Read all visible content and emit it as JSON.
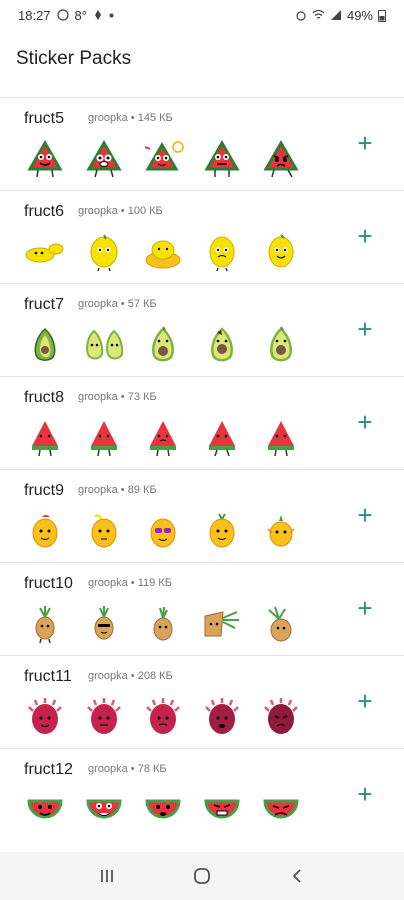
{
  "status": {
    "time": "18:27",
    "temp": "8°",
    "battery": "49%"
  },
  "app": {
    "title": "Sticker Packs"
  },
  "packs": [
    {
      "name": "fruct5",
      "meta": "groopka • 145 КБ",
      "add": "+"
    },
    {
      "name": "fruct6",
      "meta": "groopka • 100 КБ",
      "add": "+"
    },
    {
      "name": "fruct7",
      "meta": "groopka • 57 КБ",
      "add": "+"
    },
    {
      "name": "fruct8",
      "meta": "groopka • 73 КБ",
      "add": "+"
    },
    {
      "name": "fruct9",
      "meta": "groopka • 89 КБ",
      "add": "+"
    },
    {
      "name": "fruct10",
      "meta": "groopka • 119 КБ",
      "add": "+"
    },
    {
      "name": "fruct11",
      "meta": "groopka • 208 КБ",
      "add": "+"
    },
    {
      "name": "fruct12",
      "meta": "groopka • 78 КБ",
      "add": "+"
    }
  ],
  "sticker_icons": [
    "watermelon-slice-icon",
    "lemon-icon",
    "avocado-icon",
    "watermelon-wedge-icon",
    "mango-icon",
    "pineapple-icon",
    "dragonfruit-icon",
    "watermelon-round-icon"
  ],
  "colors": {
    "accent": "#2a8f7e",
    "watermelon": "#e8343d",
    "lemon": "#f6e100",
    "avocado": "#7cb342",
    "mango": "#f8c21a",
    "pineapple": "#d9a45a",
    "dragonfruit": "#c3234d"
  },
  "nav": {
    "recents": "recents-icon",
    "home": "home-icon",
    "back": "back-icon"
  }
}
